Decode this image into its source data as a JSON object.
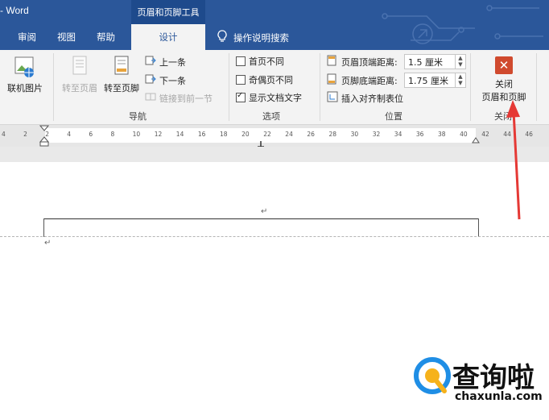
{
  "titlebar": {
    "app_title": "- Word",
    "contextual_tab": "页眉和页脚工具"
  },
  "tabs": [
    {
      "label": "审阅"
    },
    {
      "label": "视图"
    },
    {
      "label": "帮助"
    },
    {
      "label": "设计"
    }
  ],
  "tell_me": {
    "label": "操作说明搜索"
  },
  "ribbon": {
    "online_pictures": "联机图片",
    "nav": {
      "goto_header": "转至页眉",
      "goto_footer": "转至页脚",
      "previous": "上一条",
      "next": "下一条",
      "link_previous": "链接到前一节",
      "group_label": "导航"
    },
    "options": {
      "different_first": "首页不同",
      "different_odd_even": "奇偶页不同",
      "show_document_text": "显示文档文字",
      "group_label": "选项"
    },
    "position": {
      "header_from_top": "页眉顶端距离:",
      "header_value": "1.5 厘米",
      "footer_from_bottom": "页脚底端距离:",
      "footer_value": "1.75 厘米",
      "insert_alignment_tab": "插入对齐制表位",
      "group_label": "位置"
    },
    "close": {
      "line1": "关闭",
      "line2": "页眉和页脚",
      "group_label": "关闭"
    }
  },
  "ruler": {
    "labels": [
      "4",
      "2",
      "2",
      "4",
      "6",
      "8",
      "10",
      "12",
      "14",
      "16",
      "18",
      "20",
      "22",
      "24",
      "26",
      "28",
      "30",
      "32",
      "34",
      "36",
      "38",
      "40",
      "42",
      "44",
      "46"
    ]
  },
  "watermark": {
    "brand": "查询啦",
    "url": "chaxunla.com"
  },
  "colors": {
    "titlebar": "#2b579a",
    "ribbon": "#f3f3f3",
    "close_icon": "#d04a2e",
    "annotation_arrow": "#e53935"
  },
  "options_state": {
    "different_first": false,
    "different_odd_even": false,
    "show_document_text": true
  }
}
